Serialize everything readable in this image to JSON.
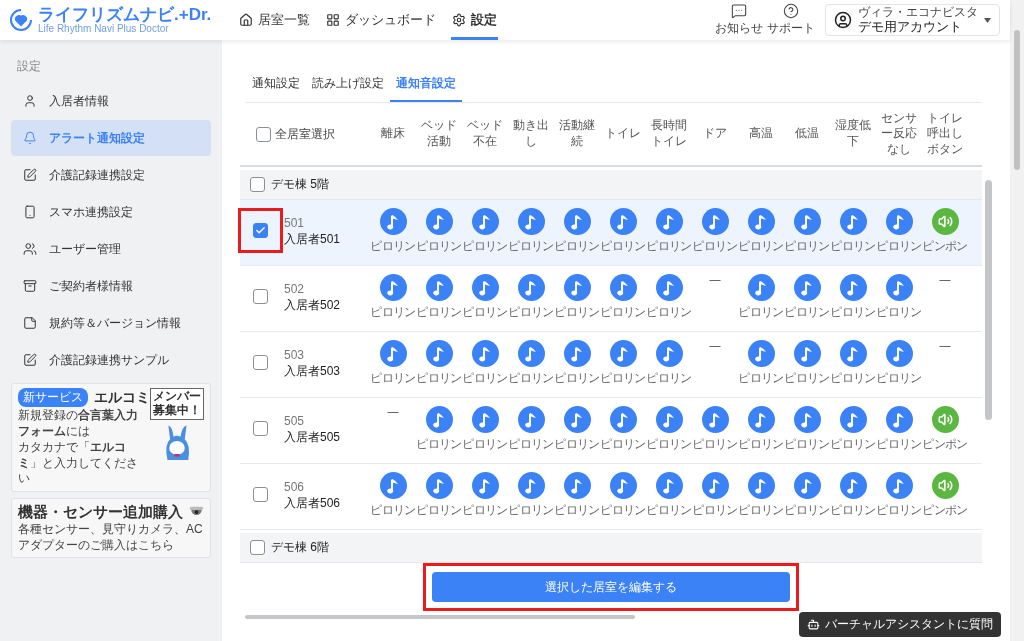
{
  "header": {
    "logo": {
      "name": "ライフリズムナビ.+Dr.",
      "tagline": "Life Rhythm Navi  Plus Doctor"
    },
    "nav": [
      {
        "label": "居室一覧",
        "selected": false
      },
      {
        "label": "ダッシュボード",
        "selected": false
      },
      {
        "label": "設定",
        "selected": true
      }
    ],
    "actions": [
      "お知らせ",
      "サポート"
    ],
    "account": {
      "facility": "ヴィラ・エコナビスタ",
      "name": "デモ用アカウント"
    }
  },
  "sidebar": {
    "section": "設定",
    "items": [
      {
        "label": "入居者情報",
        "selected": false
      },
      {
        "label": "アラート通知設定",
        "selected": true
      },
      {
        "label": "介護記録連携設定",
        "selected": false
      },
      {
        "label": "スマホ連携設定",
        "selected": false
      },
      {
        "label": "ユーザー管理",
        "selected": false
      },
      {
        "label": "ご契約者様情報",
        "selected": false
      },
      {
        "label": "規約等＆バージョン情報",
        "selected": false
      },
      {
        "label": "介護記録連携サンプル",
        "selected": false
      }
    ],
    "banners": [
      {
        "kind": "service",
        "badge": "新サービス",
        "title": "エルコミ",
        "lines": [
          "新規登録の**合言葉入力フォーム**には",
          "カタカナで「**エルコミ**」と入力してください"
        ],
        "sign": [
          "メンバー",
          "募集中！"
        ]
      },
      {
        "kind": "purchase",
        "title": "機器・センサー追加購入",
        "lines": [
          "各種センサー、見守りカメラ、ACアダプターのご購入はこちら"
        ]
      }
    ]
  },
  "tabs": [
    {
      "label": "通知設定",
      "selected": false
    },
    {
      "label": "読み上げ設定",
      "selected": false
    },
    {
      "label": "通知音設定",
      "selected": true
    }
  ],
  "table": {
    "select_all": {
      "label": "全居室選択",
      "checked": false
    },
    "columns": [
      "離床",
      "ベッド活動",
      "ベッド不在",
      "動き出し",
      "活動継続",
      "トイレ",
      "長時間トイレ",
      "ドア",
      "高温",
      "低温",
      "湿度低下",
      "センサー反応なし",
      "トイレ呼出しボタン"
    ],
    "groups": [
      {
        "name": "デモ棟 5階",
        "checked": false,
        "rows": [
          {
            "room": "501",
            "name": "入居者501",
            "checked": true,
            "highlighted": true,
            "cells": [
              {
                "kind": "melody",
                "label": "ピロリン"
              },
              {
                "kind": "melody",
                "label": "ピロリン"
              },
              {
                "kind": "melody",
                "label": "ピロリン"
              },
              {
                "kind": "melody",
                "label": "ピロリン"
              },
              {
                "kind": "melody",
                "label": "ピロリン"
              },
              {
                "kind": "melody",
                "label": "ピロリン"
              },
              {
                "kind": "melody",
                "label": "ピロリン"
              },
              {
                "kind": "melody",
                "label": "ピロリン"
              },
              {
                "kind": "melody",
                "label": "ピロリン"
              },
              {
                "kind": "melody",
                "label": "ピロリン"
              },
              {
                "kind": "melody",
                "label": "ピロリン"
              },
              {
                "kind": "melody",
                "label": "ピロリン"
              },
              {
                "kind": "chime",
                "label": "ピンポン"
              }
            ]
          },
          {
            "room": "502",
            "name": "入居者502",
            "checked": false,
            "highlighted": false,
            "cells": [
              {
                "kind": "melody",
                "label": "ピロリン"
              },
              {
                "kind": "melody",
                "label": "ピロリン"
              },
              {
                "kind": "melody",
                "label": "ピロリン"
              },
              {
                "kind": "melody",
                "label": "ピロリン"
              },
              {
                "kind": "melody",
                "label": "ピロリン"
              },
              {
                "kind": "melody",
                "label": "ピロリン"
              },
              {
                "kind": "melody",
                "label": "ピロリン"
              },
              {
                "kind": "none",
                "label": "—"
              },
              {
                "kind": "melody",
                "label": "ピロリン"
              },
              {
                "kind": "melody",
                "label": "ピロリン"
              },
              {
                "kind": "melody",
                "label": "ピロリン"
              },
              {
                "kind": "melody",
                "label": "ピロリン"
              },
              {
                "kind": "none",
                "label": "—"
              }
            ]
          },
          {
            "room": "503",
            "name": "入居者503",
            "checked": false,
            "highlighted": false,
            "cells": [
              {
                "kind": "melody",
                "label": "ピロリン"
              },
              {
                "kind": "melody",
                "label": "ピロリン"
              },
              {
                "kind": "melody",
                "label": "ピロリン"
              },
              {
                "kind": "melody",
                "label": "ピロリン"
              },
              {
                "kind": "melody",
                "label": "ピロリン"
              },
              {
                "kind": "melody",
                "label": "ピロリン"
              },
              {
                "kind": "melody",
                "label": "ピロリン"
              },
              {
                "kind": "none",
                "label": "—"
              },
              {
                "kind": "melody",
                "label": "ピロリン"
              },
              {
                "kind": "melody",
                "label": "ピロリン"
              },
              {
                "kind": "melody",
                "label": "ピロリン"
              },
              {
                "kind": "melody",
                "label": "ピロリン"
              },
              {
                "kind": "none",
                "label": "—"
              }
            ]
          },
          {
            "room": "505",
            "name": "入居者505",
            "checked": false,
            "highlighted": false,
            "cells": [
              {
                "kind": "none",
                "label": "—"
              },
              {
                "kind": "melody",
                "label": "ピロリン"
              },
              {
                "kind": "melody",
                "label": "ピロリン"
              },
              {
                "kind": "melody",
                "label": "ピロリン"
              },
              {
                "kind": "melody",
                "label": "ピロリン"
              },
              {
                "kind": "melody",
                "label": "ピロリン"
              },
              {
                "kind": "melody",
                "label": "ピロリン"
              },
              {
                "kind": "melody",
                "label": "ピロリン"
              },
              {
                "kind": "melody",
                "label": "ピロリン"
              },
              {
                "kind": "melody",
                "label": "ピロリン"
              },
              {
                "kind": "melody",
                "label": "ピロリン"
              },
              {
                "kind": "melody",
                "label": "ピロリン"
              },
              {
                "kind": "chime",
                "label": "ピンポン"
              }
            ]
          },
          {
            "room": "506",
            "name": "入居者506",
            "checked": false,
            "highlighted": false,
            "cells": [
              {
                "kind": "melody",
                "label": "ピロリン"
              },
              {
                "kind": "melody",
                "label": "ピロリン"
              },
              {
                "kind": "melody",
                "label": "ピロリン"
              },
              {
                "kind": "melody",
                "label": "ピロリン"
              },
              {
                "kind": "melody",
                "label": "ピロリン"
              },
              {
                "kind": "melody",
                "label": "ピロリン"
              },
              {
                "kind": "melody",
                "label": "ピロリン"
              },
              {
                "kind": "melody",
                "label": "ピロリン"
              },
              {
                "kind": "melody",
                "label": "ピロリン"
              },
              {
                "kind": "melody",
                "label": "ピロリン"
              },
              {
                "kind": "melody",
                "label": "ピロリン"
              },
              {
                "kind": "melody",
                "label": "ピロリン"
              },
              {
                "kind": "chime",
                "label": "ピンポン"
              }
            ]
          }
        ]
      },
      {
        "name": "デモ棟 6階",
        "checked": false
      }
    ]
  },
  "edit_button": {
    "label": "選択した居室を編集する",
    "highlighted": true
  },
  "assistant_button": {
    "label": "バーチャルアシスタントに質問"
  }
}
